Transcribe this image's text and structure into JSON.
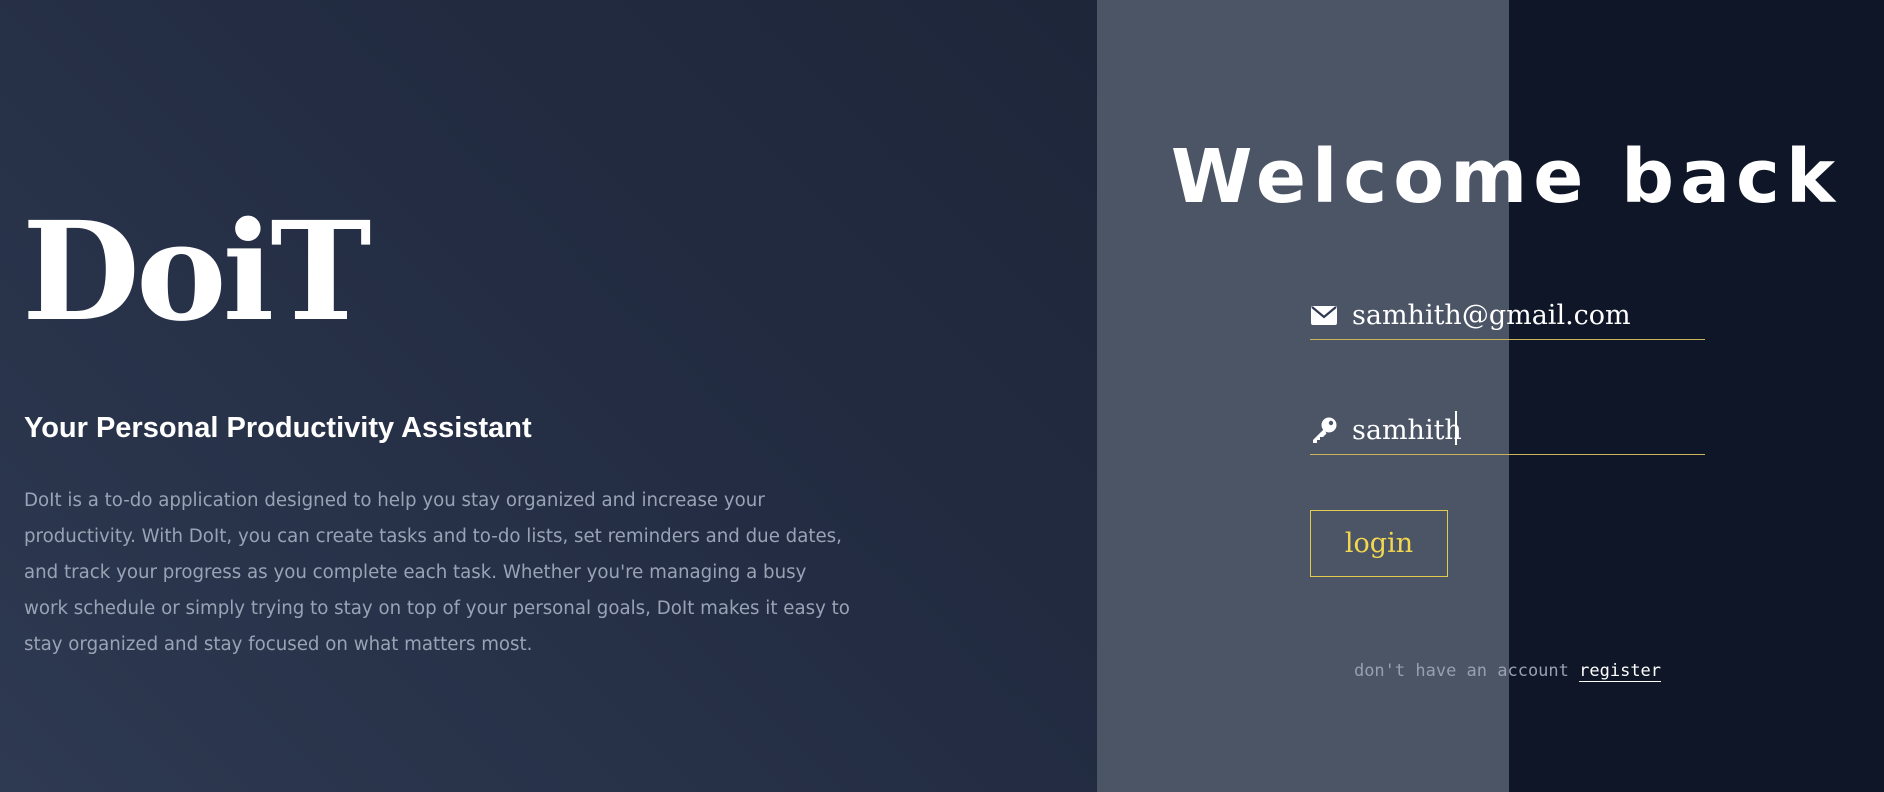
{
  "brand": {
    "name": "DoiT",
    "tagline": "Your Personal Productivity Assistant",
    "description": "DoIt is a to-do application designed to help you stay organized and increase your productivity. With DoIt, you can create tasks and to-do lists, set reminders and due dates, and track your progress as you complete each task. Whether you're managing a busy work schedule or simply trying to stay on top of your personal goals, DoIt makes it easy to stay organized and stay focused on what matters most."
  },
  "login": {
    "heading": "Welcome back",
    "email": {
      "value": "samhith@gmail.com",
      "icon": "envelope-icon"
    },
    "password": {
      "value": "samhith",
      "icon": "key-icon"
    },
    "button_label": "login",
    "register_prompt": "don't have an account",
    "register_link": "register"
  },
  "colors": {
    "left_background": "#232c42",
    "middle_panel": "#4b5566",
    "right_panel": "#0f1628",
    "accent": "#e3cc4d",
    "text_primary": "#ffffff",
    "text_muted": "#9aa3b5"
  }
}
